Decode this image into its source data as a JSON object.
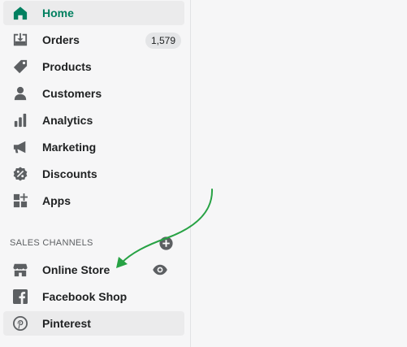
{
  "sidebar": {
    "items": [
      {
        "label": "Home",
        "icon": "home-icon",
        "active": true
      },
      {
        "label": "Orders",
        "icon": "orders-icon",
        "badge": "1,579"
      },
      {
        "label": "Products",
        "icon": "tag-icon"
      },
      {
        "label": "Customers",
        "icon": "person-icon"
      },
      {
        "label": "Analytics",
        "icon": "bar-chart-icon"
      },
      {
        "label": "Marketing",
        "icon": "megaphone-icon"
      },
      {
        "label": "Discounts",
        "icon": "discount-badge-icon"
      },
      {
        "label": "Apps",
        "icon": "apps-grid-icon"
      }
    ],
    "sales_channels": {
      "title": "SALES CHANNELS",
      "items": [
        {
          "label": "Online Store",
          "icon": "store-icon"
        },
        {
          "label": "Facebook Shop",
          "icon": "facebook-icon"
        },
        {
          "label": "Pinterest",
          "icon": "pinterest-icon",
          "highlighted": true
        }
      ]
    }
  },
  "colors": {
    "active_text": "#008060",
    "icon": "#5c5f62",
    "annotation_arrow": "#27a244",
    "hover_background": "#ebebec"
  }
}
